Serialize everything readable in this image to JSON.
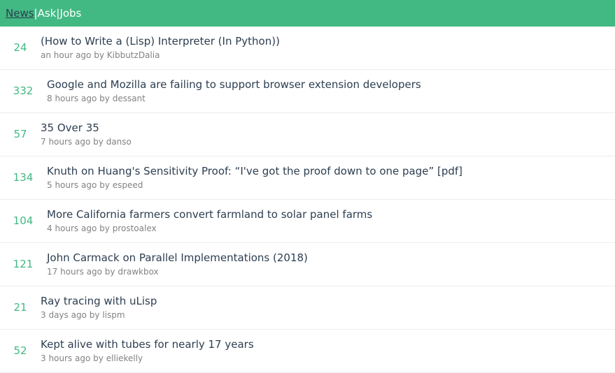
{
  "nav": {
    "news": "News",
    "sep1": "|",
    "ask": "Ask",
    "sep2": "|",
    "jobs": "Jobs"
  },
  "colors": {
    "accent": "#42b983",
    "title": "#2c3e50",
    "meta": "#828282"
  },
  "stories": [
    {
      "score": "24",
      "title": "(How to Write a (Lisp) Interpreter (In Python))",
      "time": "an hour ago",
      "by": "by",
      "user": "KibbutzDalia"
    },
    {
      "score": "332",
      "title": "Google and Mozilla are failing to support browser extension developers",
      "time": "8 hours ago",
      "by": "by",
      "user": "dessant"
    },
    {
      "score": "57",
      "title": "35 Over 35",
      "time": "7 hours ago",
      "by": "by",
      "user": "danso"
    },
    {
      "score": "134",
      "title": "Knuth on Huang's Sensitivity Proof: “I've got the proof down to one page” [pdf]",
      "time": "5 hours ago",
      "by": "by",
      "user": "espeed"
    },
    {
      "score": "104",
      "title": "More California farmers convert farmland to solar panel farms",
      "time": "4 hours ago",
      "by": "by",
      "user": "prostoalex"
    },
    {
      "score": "121",
      "title": "John Carmack on Parallel Implementations (2018)",
      "time": "17 hours ago",
      "by": "by",
      "user": "drawkbox"
    },
    {
      "score": "21",
      "title": "Ray tracing with uLisp",
      "time": "3 days ago",
      "by": "by",
      "user": "lispm"
    },
    {
      "score": "52",
      "title": "Kept alive with tubes for nearly 17 years",
      "time": "3 hours ago",
      "by": "by",
      "user": "elliekelly"
    }
  ]
}
